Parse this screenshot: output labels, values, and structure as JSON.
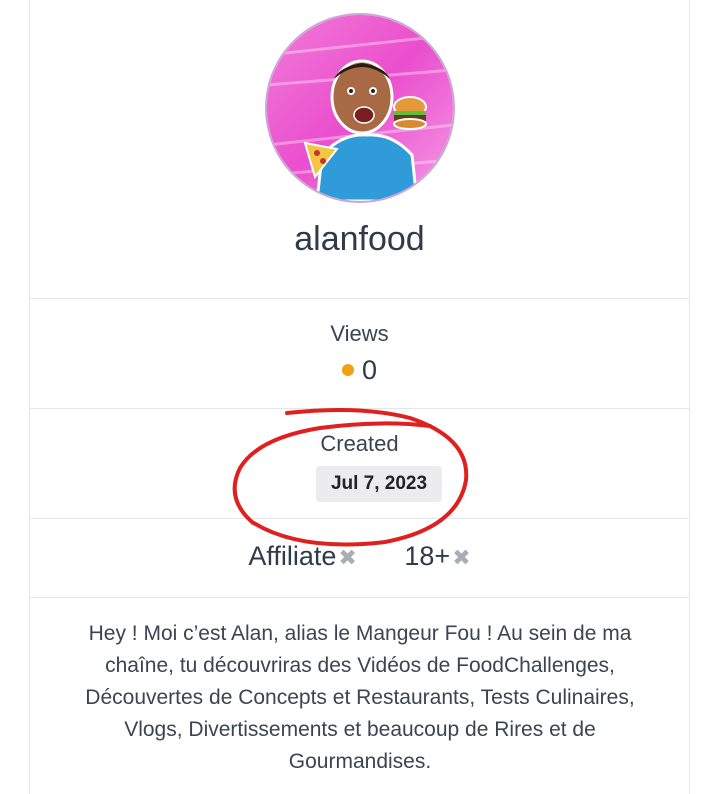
{
  "profile": {
    "username": "alanfood",
    "avatar_icon": "avatar-illustration"
  },
  "stats": {
    "views_label": "Views",
    "views_value": "0",
    "views_dot_color": "#f2a013",
    "created_label": "Created",
    "created_value": "Jul 7, 2023"
  },
  "tags": [
    {
      "label": "Affiliate",
      "remove_icon": "✖"
    },
    {
      "label": "18+",
      "remove_icon": "✖"
    }
  ],
  "bio": "Hey ! Moi c’est Alan, alias le Mangeur Fou ! Au sein de ma chaîne, tu découvriras des Vidéos de FoodChallenges, Découvertes de Concepts et Restaurants, Tests Culinaires, Vlogs, Divertissements et beaucoup de Rires et de Gourmandises.",
  "annotation": {
    "color": "#e02020",
    "shape": "hand-drawn-circle"
  }
}
